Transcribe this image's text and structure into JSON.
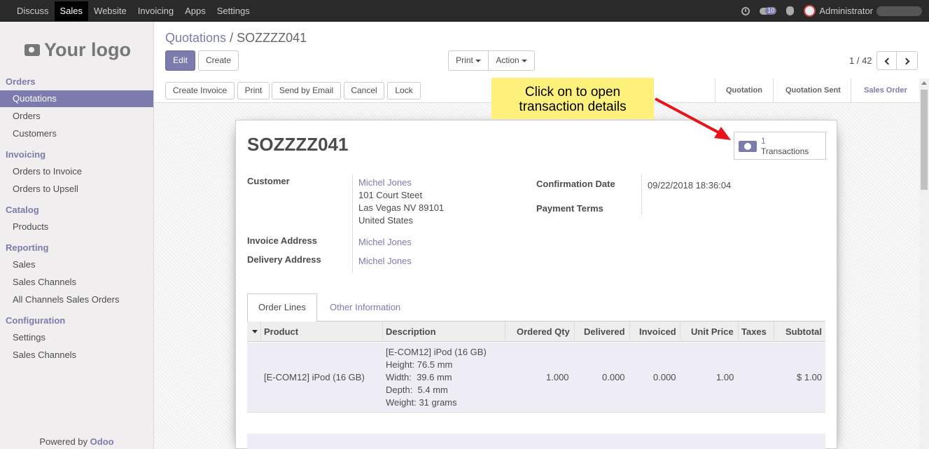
{
  "topbar": {
    "menu": [
      "Discuss",
      "Sales",
      "Website",
      "Invoicing",
      "Apps",
      "Settings"
    ],
    "active": "Sales",
    "message_count": "10",
    "user_name": "Administrator"
  },
  "sidebar": {
    "logo_text": "Your logo",
    "sections": {
      "orders": "Orders",
      "invoicing": "Invoicing",
      "catalog": "Catalog",
      "reporting": "Reporting",
      "configuration": "Configuration"
    },
    "items": {
      "quotations": "Quotations",
      "orders": "Orders",
      "customers": "Customers",
      "orders_to_invoice": "Orders to Invoice",
      "orders_to_upsell": "Orders to Upsell",
      "products": "Products",
      "sales": "Sales",
      "sales_channels": "Sales Channels",
      "all_channels_sales_orders": "All Channels Sales Orders",
      "settings": "Settings",
      "config_sales_channels": "Sales Channels"
    },
    "powered_by": "Powered by",
    "powered_brand": "Odoo"
  },
  "control": {
    "breadcrumb_parent": "Quotations",
    "breadcrumb_sep": "/",
    "breadcrumb_current": "SOZZZZ041",
    "edit": "Edit",
    "create": "Create",
    "print": "Print",
    "action": "Action",
    "pager": "1 / 42"
  },
  "header_buttons": {
    "create_invoice": "Create Invoice",
    "print": "Print",
    "send_by_email": "Send by Email",
    "cancel": "Cancel",
    "lock": "Lock"
  },
  "statusbar": {
    "stages": [
      "Quotation",
      "Quotation Sent",
      "Sales Order"
    ],
    "active": "Sales Order"
  },
  "callout": {
    "line1": "Click on to open",
    "line2": "transaction details"
  },
  "form": {
    "title": "SOZZZZ041",
    "smart_button": {
      "value": "1",
      "label": "Transactions"
    },
    "customer_label": "Customer",
    "customer_name": "Michel Jones",
    "customer_addr1": "101 Court Steet",
    "customer_addr2": "Las Vegas NV 89101",
    "customer_addr3": "United States",
    "invoice_address_label": "Invoice Address",
    "invoice_address": "Michel Jones",
    "delivery_address_label": "Delivery Address",
    "delivery_address": "Michel Jones",
    "confirmation_date_label": "Confirmation Date",
    "confirmation_date": "09/22/2018 18:36:04",
    "payment_terms_label": "Payment Terms"
  },
  "notebook": {
    "tabs": [
      "Order Lines",
      "Other Information"
    ],
    "active": "Order Lines"
  },
  "order_lines": {
    "columns": [
      "Product",
      "Description",
      "Ordered Qty",
      "Delivered",
      "Invoiced",
      "Unit Price",
      "Taxes",
      "Subtotal"
    ],
    "rows": [
      {
        "product": "[E-COM12] iPod (16 GB)",
        "description": [
          "[E-COM12] iPod (16 GB)",
          "Height: 76.5 mm",
          "Width:  39.6 mm",
          "Depth:  5.4 mm",
          "Weight: 31 grams"
        ],
        "ordered_qty": "1.000",
        "delivered": "0.000",
        "invoiced": "0.000",
        "unit_price": "1.00",
        "taxes": "",
        "subtotal": "$ 1.00"
      }
    ]
  }
}
